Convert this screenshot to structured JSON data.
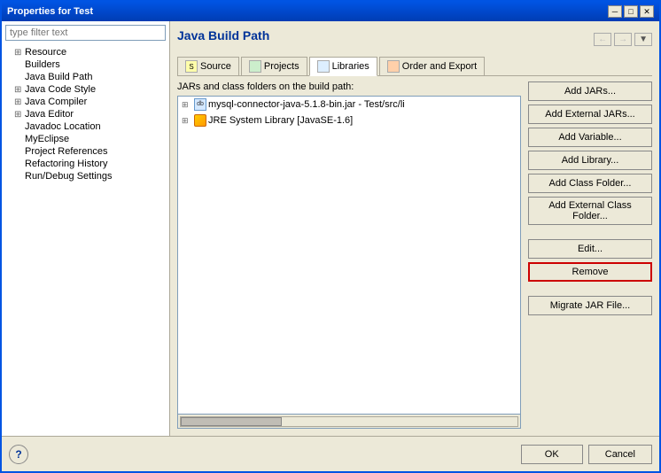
{
  "window": {
    "title": "Properties for Test",
    "controls": {
      "minimize": "─",
      "maximize": "□",
      "close": "✕"
    }
  },
  "sidebar": {
    "filter_placeholder": "type filter text",
    "items": [
      {
        "label": "Resource",
        "indent": 1,
        "expandable": true
      },
      {
        "label": "Builders",
        "indent": 1,
        "expandable": false
      },
      {
        "label": "Java Build Path",
        "indent": 1,
        "expandable": false
      },
      {
        "label": "Java Code Style",
        "indent": 1,
        "expandable": true
      },
      {
        "label": "Java Compiler",
        "indent": 1,
        "expandable": true
      },
      {
        "label": "Java Editor",
        "indent": 1,
        "expandable": true
      },
      {
        "label": "Javadoc Location",
        "indent": 1,
        "expandable": false
      },
      {
        "label": "MyEclipse",
        "indent": 1,
        "expandable": false
      },
      {
        "label": "Project References",
        "indent": 1,
        "expandable": false
      },
      {
        "label": "Refactoring History",
        "indent": 1,
        "expandable": false
      },
      {
        "label": "Run/Debug Settings",
        "indent": 1,
        "expandable": false
      }
    ]
  },
  "main": {
    "title": "Java Build Path",
    "tabs": [
      {
        "label": "Source",
        "icon": "source-icon",
        "active": false
      },
      {
        "label": "Projects",
        "icon": "projects-icon",
        "active": false
      },
      {
        "label": "Libraries",
        "icon": "libraries-icon",
        "active": true
      },
      {
        "label": "Order and Export",
        "icon": "order-icon",
        "active": false
      }
    ],
    "jar_list_label": "JARs and class folders on the build path:",
    "entries": [
      {
        "label": "mysql-connector-java-5.1.8-bin.jar - Test/src/li",
        "type": "jar",
        "expandable": true
      },
      {
        "label": "JRE System Library [JavaSE-1.6]",
        "type": "jre",
        "expandable": true
      }
    ],
    "buttons": [
      {
        "label": "Add JARs...",
        "name": "add-jars-button",
        "highlighted": false
      },
      {
        "label": "Add External JARs...",
        "name": "add-external-jars-button",
        "highlighted": false
      },
      {
        "label": "Add Variable...",
        "name": "add-variable-button",
        "highlighted": false
      },
      {
        "label": "Add Library...",
        "name": "add-library-button",
        "highlighted": false
      },
      {
        "label": "Add Class Folder...",
        "name": "add-class-folder-button",
        "highlighted": false
      },
      {
        "label": "Add External Class Folder...",
        "name": "add-external-class-folder-button",
        "highlighted": false
      },
      {
        "label": "Edit...",
        "name": "edit-button",
        "highlighted": false
      },
      {
        "label": "Remove",
        "name": "remove-button",
        "highlighted": true
      },
      {
        "label": "Migrate JAR File...",
        "name": "migrate-jar-button",
        "highlighted": false
      }
    ]
  },
  "footer": {
    "help_label": "?",
    "ok_label": "OK",
    "cancel_label": "Cancel"
  },
  "nav": {
    "back": "←",
    "forward": "→",
    "dropdown": "▼"
  }
}
